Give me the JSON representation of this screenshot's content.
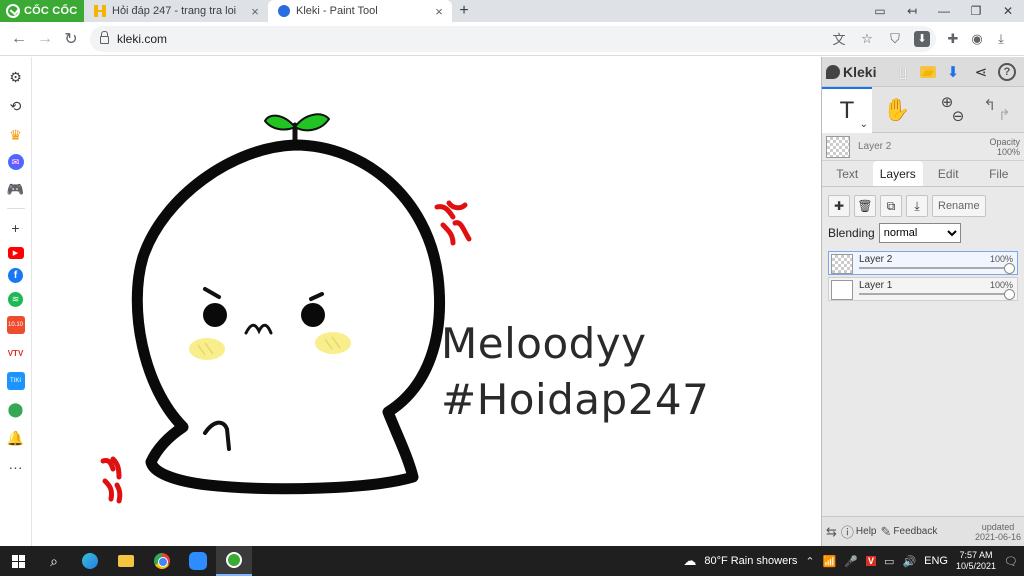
{
  "browser": {
    "brand": "CỐC CỐC",
    "tabs": [
      {
        "label": "Hỏi đáp 247 - trang tra loi",
        "active": false
      },
      {
        "label": "Kleki - Paint Tool",
        "active": true
      }
    ],
    "url": "kleki.com"
  },
  "canvas": {
    "line1": "Meloodyy",
    "line2": "#Hoidap247"
  },
  "kleki": {
    "logo": "Kleki",
    "current_layer": "Layer 2",
    "opacity_label": "Opacity",
    "opacity_value": "100%",
    "tabs": [
      "Text",
      "Layers",
      "Edit",
      "File"
    ],
    "active_tab": "Layers",
    "rename_label": "Rename",
    "blending_label": "Blending",
    "blending_value": "normal",
    "layers": [
      {
        "name": "Layer 2",
        "opacity": "100%",
        "selected": true
      },
      {
        "name": "Layer 1",
        "opacity": "100%",
        "selected": false
      }
    ],
    "help_label": "Help",
    "feedback_label": "Feedback",
    "updated_label": "updated",
    "updated_date": "2021-06-16"
  },
  "taskbar": {
    "weather": "80°F  Rain showers",
    "lang": "ENG",
    "time": "7:57 AM",
    "date": "10/5/2021"
  },
  "colors": {
    "brand_green": "#3aaa35",
    "sprout_green": "#22c423",
    "anger_red": "#e01010",
    "blush_yellow": "#f9ee8c"
  }
}
